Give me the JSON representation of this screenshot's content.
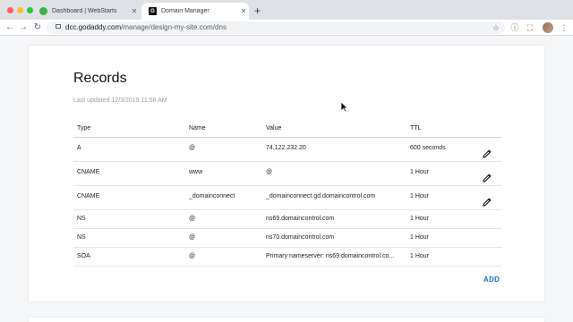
{
  "browser": {
    "tabs": [
      {
        "title": "Dashboard | WebStarts",
        "active": false
      },
      {
        "title": "Domain Manager",
        "active": true
      }
    ],
    "url_host": "dcc.godaddy.com",
    "url_path": "/manage/design-my-site.com/dns"
  },
  "page": {
    "title": "Records",
    "last_updated": "Last updated 12/3/2019 11:58 AM",
    "columns": [
      "Type",
      "Name",
      "Value",
      "TTL"
    ],
    "records": [
      {
        "type": "A",
        "name": "@",
        "value": "74.122.232.20",
        "ttl": "600 seconds",
        "editable": true
      },
      {
        "type": "CNAME",
        "name": "www",
        "value": "@",
        "ttl": "1 Hour",
        "editable": true
      },
      {
        "type": "CNAME",
        "name": "_domainconnect",
        "value": "_domainconnect.gd.domaincontrol.com",
        "ttl": "1 Hour",
        "editable": true
      },
      {
        "type": "NS",
        "name": "@",
        "value": "ns69.domaincontrol.com",
        "ttl": "1 Hour",
        "editable": false
      },
      {
        "type": "NS",
        "name": "@",
        "value": "ns70.domaincontrol.com",
        "ttl": "1 Hour",
        "editable": false
      },
      {
        "type": "SOA",
        "name": "@",
        "value": "Primary nameserver: ns69.domaincontrol.co...",
        "ttl": "1 Hour",
        "editable": false
      }
    ],
    "add_label": "ADD"
  },
  "colors": {
    "accent": "#1a73b8"
  }
}
